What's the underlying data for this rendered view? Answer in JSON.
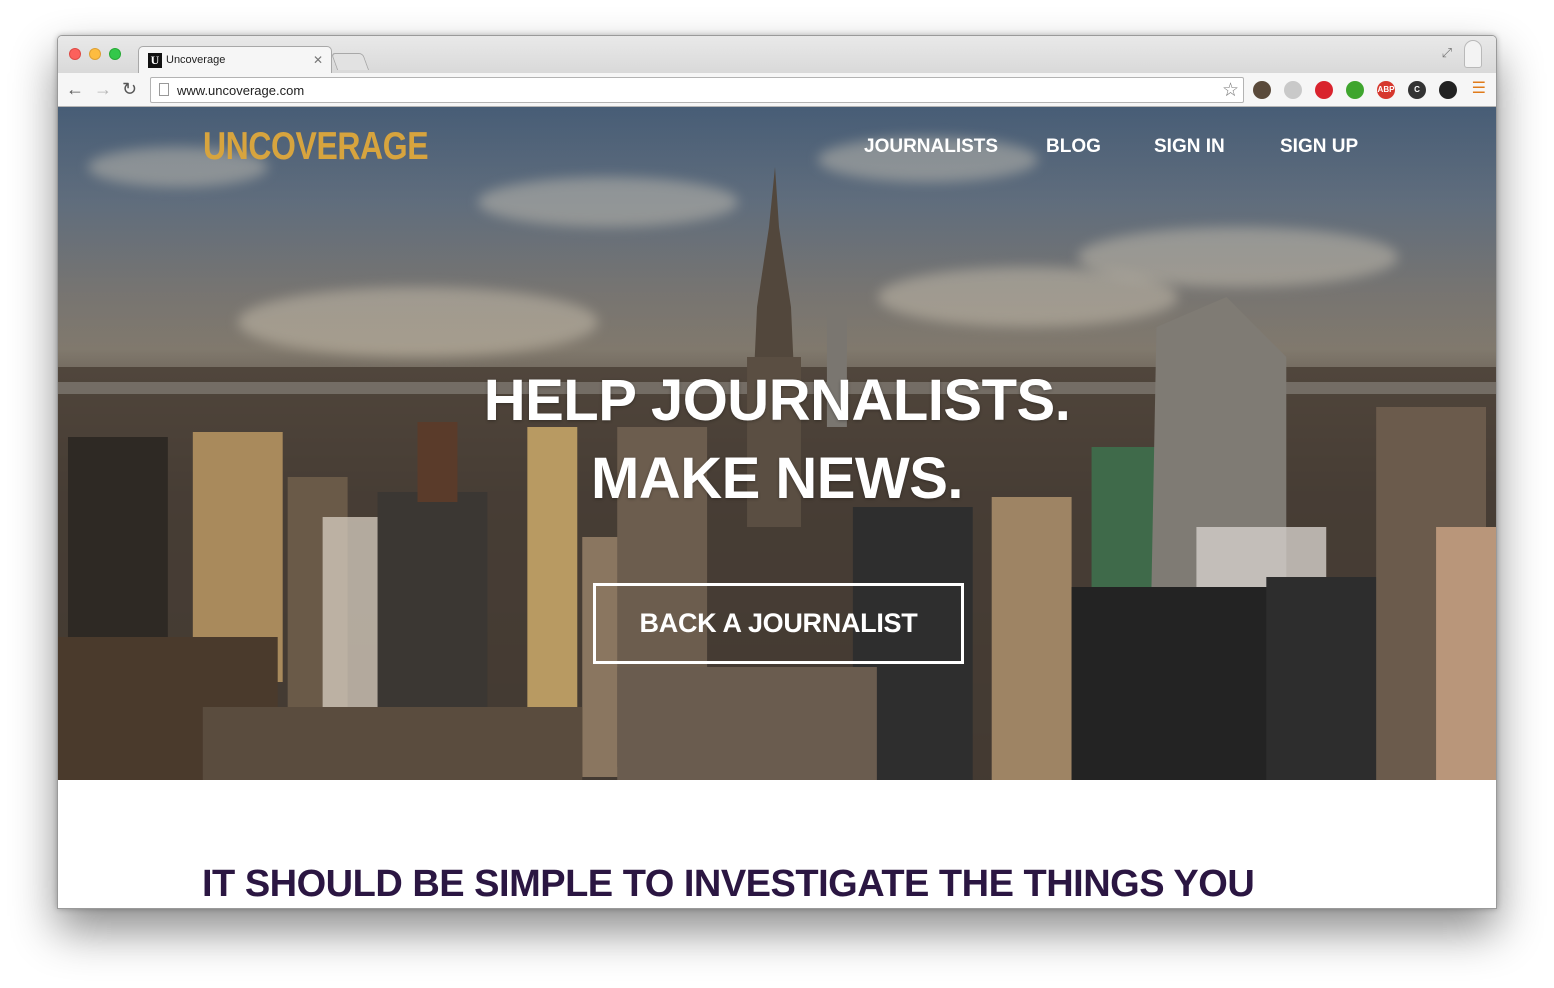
{
  "browser": {
    "tab_title": "Uncoverage",
    "tab_favicon": "U",
    "url": "www.uncoverage.com"
  },
  "site": {
    "logo": "UNCOVERAGE",
    "nav": {
      "journalists": "JOURNALISTS",
      "blog": "BLOG",
      "sign_in": "SIGN IN",
      "sign_up": "SIGN UP"
    },
    "hero": {
      "headline_line1": "HELP JOURNALISTS.",
      "headline_line2": "MAKE NEWS.",
      "cta": "BACK A JOURNALIST"
    },
    "section_heading": "IT SHOULD BE SIMPLE TO INVESTIGATE THE THINGS YOU"
  },
  "extensions": [
    {
      "icon": "camera-extension-icon",
      "label": "",
      "color": "#5a4a3a"
    },
    {
      "icon": "shield-extension-icon",
      "label": "",
      "color": "#c9c9c9"
    },
    {
      "icon": "stop-extension-icon",
      "label": "",
      "color": "#d9232d"
    },
    {
      "icon": "download-extension-icon",
      "label": "",
      "color": "#3fa52e"
    },
    {
      "icon": "adblock-extension-icon",
      "label": "ABP",
      "color": "#d6372d"
    },
    {
      "icon": "c-extension-icon",
      "label": "C",
      "color": "#333333"
    },
    {
      "icon": "color-extension-icon",
      "label": "",
      "color": "#222222"
    }
  ],
  "colors": {
    "logo": "#d7a43e",
    "heading": "#2b1642",
    "menu_accent": "#e07b1a"
  }
}
